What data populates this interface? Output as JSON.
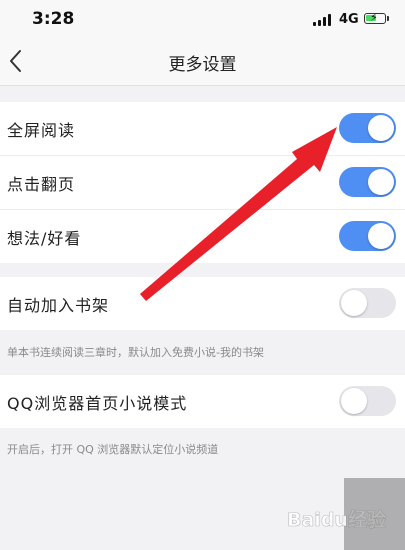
{
  "status_bar": {
    "time": "3:28",
    "network": "4G",
    "battery_icon": "battery-charging-icon",
    "signal_icon": "signal-bars-icon"
  },
  "nav": {
    "title": "更多设置",
    "back_icon": "chevron-left-icon"
  },
  "settings": {
    "group1": [
      {
        "label": "全屏阅读",
        "enabled": true
      },
      {
        "label": "点击翻页",
        "enabled": true
      },
      {
        "label": "想法/好看",
        "enabled": true
      }
    ],
    "group2": {
      "label": "自动加入书架",
      "enabled": false,
      "note": "单本书连续阅读三章时，默认加入免费小说-我的书架"
    },
    "group3": {
      "label": "QQ浏览器首页小说模式",
      "enabled": false,
      "note": "开启后，打开 QQ 浏览器默认定位小说频道"
    }
  },
  "colors": {
    "toggle_on": "#4f8ef2",
    "toggle_off": "#e6e6ea",
    "annotation_arrow": "#e8202a"
  },
  "watermark": {
    "text": "Baidu经验"
  }
}
